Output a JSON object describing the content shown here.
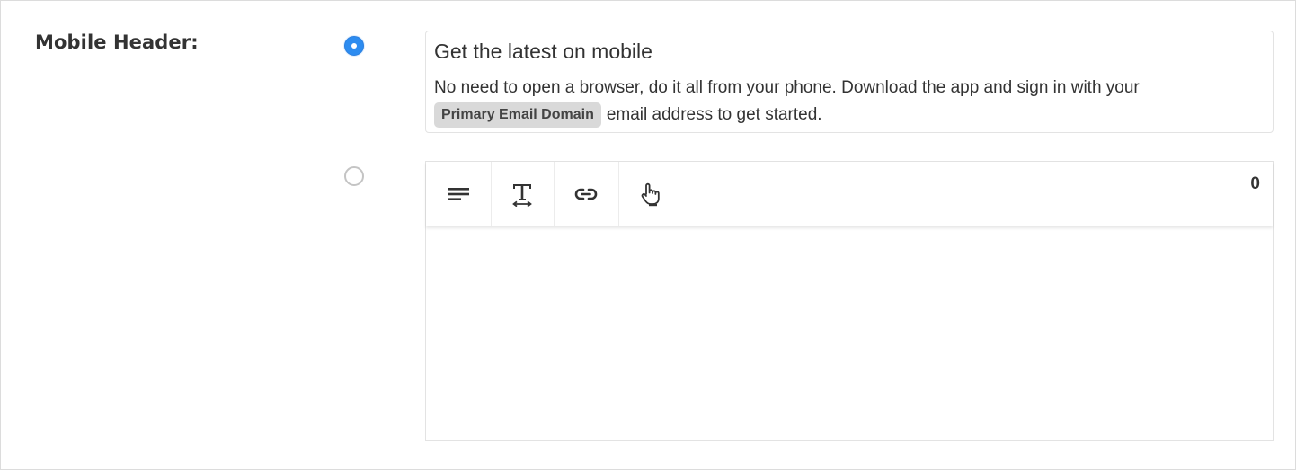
{
  "field": {
    "label": "Mobile Header:"
  },
  "options": {
    "preset": {
      "selected": true,
      "title": "Get the latest on mobile",
      "body_before": "No need to open a browser, do it all from your phone. Download the app and sign in with your",
      "token": "Primary Email Domain",
      "body_after": "email address to get started."
    },
    "custom": {
      "selected": false
    }
  },
  "editor": {
    "char_count": "0",
    "toolbar": [
      {
        "name": "align-left-icon"
      },
      {
        "name": "text-size-icon"
      },
      {
        "name": "link-icon"
      },
      {
        "name": "pointer-hand-icon"
      }
    ]
  },
  "colors": {
    "accent": "#2d8cf0",
    "border": "#e3e3e3",
    "token_bg": "#d9d9d9"
  }
}
